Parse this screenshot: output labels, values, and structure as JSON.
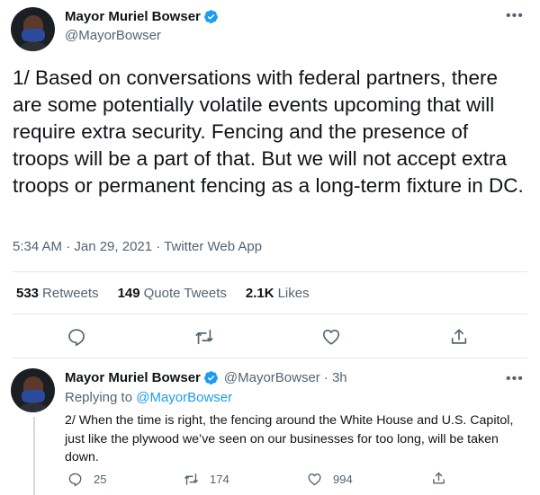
{
  "tweet": {
    "author": {
      "display_name": "Mayor Muriel Bowser",
      "handle": "@MayorBowser",
      "verified": true
    },
    "text": "1/ Based on conversations with federal partners, there are some potentially volatile events upcoming that will require extra security. Fencing and the presence of troops will be a part of that. But we will not accept extra troops or permanent fencing as a long-term fixture in DC.",
    "timestamp": "5:34 AM · Jan 29, 2021 · Twitter Web App",
    "stats": {
      "retweets_count": "533",
      "retweets_label": "Retweets",
      "quotes_count": "149",
      "quotes_label": "Quote Tweets",
      "likes_count": "2.1K",
      "likes_label": "Likes"
    },
    "actions": [
      "reply-icon",
      "retweet-icon",
      "like-icon",
      "share-icon"
    ]
  },
  "reply": {
    "author": {
      "display_name": "Mayor Muriel Bowser",
      "handle": "@MayorBowser",
      "time": "· 3h"
    },
    "replying_prefix": "Replying to",
    "replying_to": "@MayorBowser",
    "text": "2/ When the time is right, the fencing around the White House and U.S. Capitol, just like the plywood we’ve seen on our businesses for too long, will be taken down.",
    "counts": {
      "replies": "25",
      "retweets": "174",
      "likes": "994"
    }
  },
  "colors": {
    "accent": "#1d9bf0",
    "text": "#0f1419",
    "muted": "#536471",
    "divider": "#e1e8ed"
  }
}
